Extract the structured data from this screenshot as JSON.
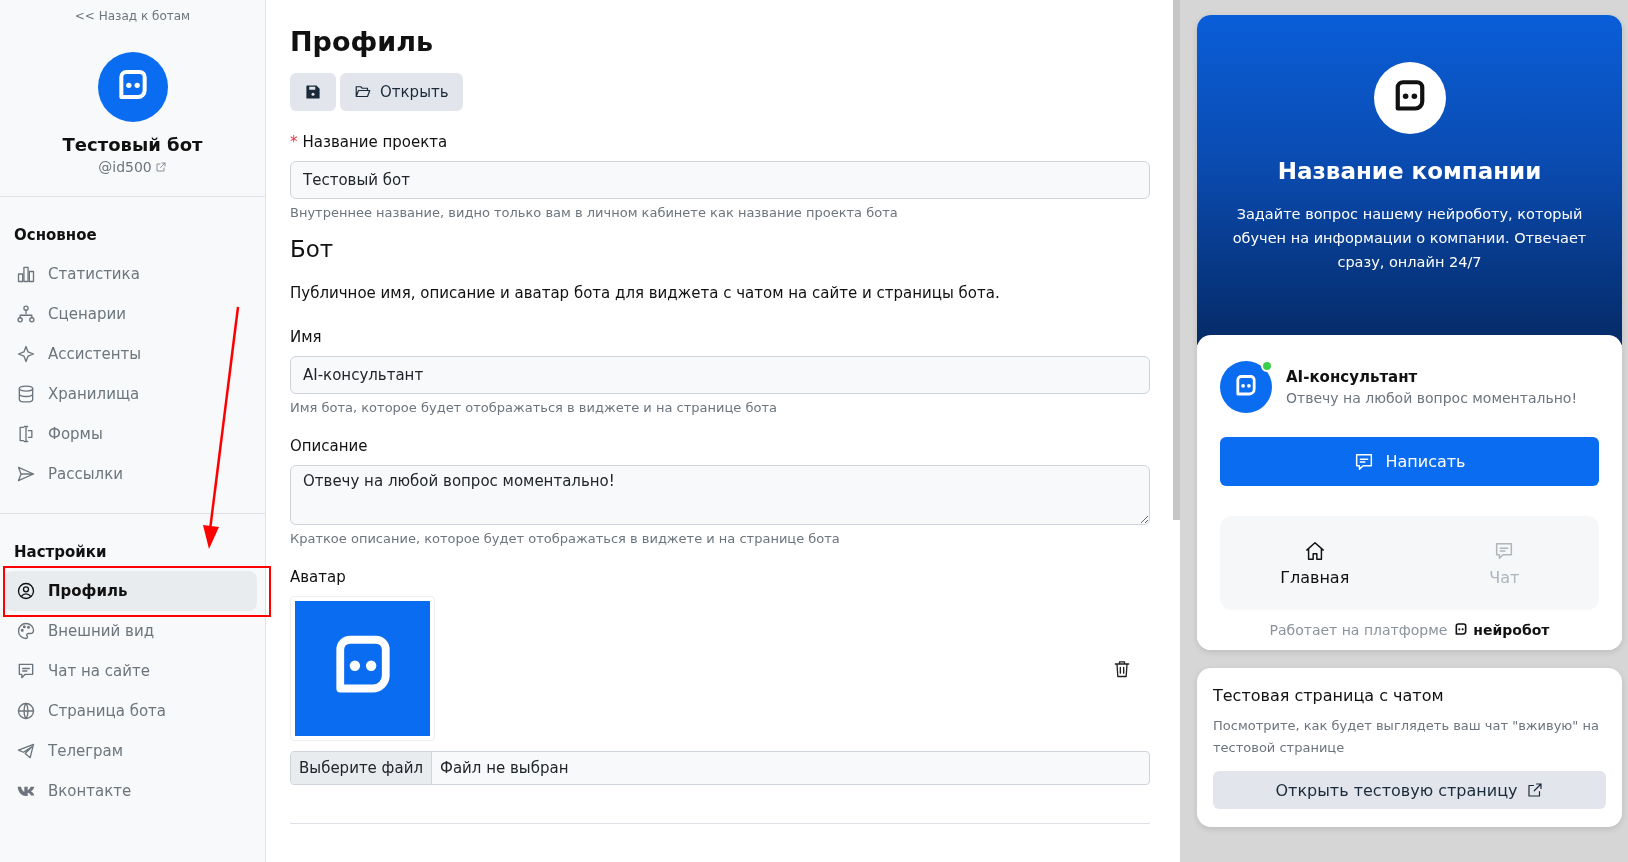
{
  "sidebar": {
    "back_link": "<< Назад к ботам",
    "bot_name": "Тестовый бот",
    "bot_handle": "@id500",
    "sections": [
      {
        "title": "Основное",
        "items": [
          {
            "label": "Статистика",
            "kind": "stats",
            "selected": false
          },
          {
            "label": "Сценарии",
            "kind": "flow",
            "selected": false
          },
          {
            "label": "Ассистенты",
            "kind": "sparkle",
            "selected": false
          },
          {
            "label": "Хранилища",
            "kind": "database",
            "selected": false
          },
          {
            "label": "Формы",
            "kind": "form",
            "selected": false
          },
          {
            "label": "Рассылки",
            "kind": "send",
            "selected": false
          }
        ]
      },
      {
        "title": "Настройки",
        "items": [
          {
            "label": "Профиль",
            "kind": "user",
            "selected": true
          },
          {
            "label": "Внешний вид",
            "kind": "palette",
            "selected": false
          },
          {
            "label": "Чат на сайте",
            "kind": "chat",
            "selected": false
          },
          {
            "label": "Страница бота",
            "kind": "globe",
            "selected": false
          },
          {
            "label": "Телеграм",
            "kind": "telegram",
            "selected": false
          },
          {
            "label": "Вконтакте",
            "kind": "vk",
            "selected": false
          }
        ]
      }
    ]
  },
  "main": {
    "title": "Профиль",
    "open_button": "Открыть",
    "project": {
      "label": "Название проекта",
      "required": true,
      "required_mark": "*",
      "value": "Тестовый бот",
      "help": "Внутреннее название, видно только вам в личном кабинете как название проекта бота"
    },
    "bot_heading": "Бот",
    "bot_description": "Публичное имя, описание и аватар бота для виджета с чатом на сайте и страницы бота.",
    "name": {
      "label": "Имя",
      "value": "AI-консультант",
      "help": "Имя бота, которое будет отображаться в виджете и на странице бота"
    },
    "description": {
      "label": "Описание",
      "value": "Отвечу на любой вопрос моментально!",
      "help": "Краткое описание, которое будет отображаться в виджете и на странице бота"
    },
    "avatar": {
      "label": "Аватар",
      "file_button": "Выберите файл",
      "file_status": "Файл не выбран"
    }
  },
  "preview": {
    "company_name": "Название компании",
    "company_text": "Задайте вопрос нашему нейроботу, который обучен на информации о компании. Отвечает сразу, онлайн 24/7",
    "bot_name": "AI-консультант",
    "bot_status": "Отвечу на любой вопрос моментально!",
    "online": true,
    "write_button": "Написать",
    "nav": [
      {
        "label": "Главная",
        "kind": "home",
        "selected": true
      },
      {
        "label": "Чат",
        "kind": "chat",
        "selected": false
      }
    ],
    "powered_by": "Работает на платформе",
    "brand": "нейробот",
    "test_title": "Тестовая страница с чатом",
    "test_text": "Посмотрите, как будет выглядеть ваш чат \"вживую\" на тестовой странице",
    "test_button": "Открыть тестовую страницу"
  }
}
